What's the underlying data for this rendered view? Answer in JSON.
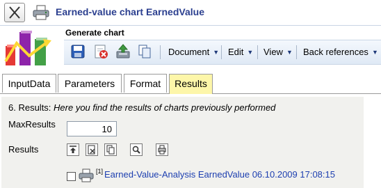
{
  "window": {
    "title": "Earned-value chart EarnedValue"
  },
  "toolbar": {
    "section_label": "Generate chart",
    "icons": [
      "save-icon",
      "delete-icon",
      "upload-icon",
      "copy-icon"
    ],
    "menus": [
      {
        "label": "Document"
      },
      {
        "label": "Edit"
      },
      {
        "label": "View"
      },
      {
        "label": "Back references"
      }
    ]
  },
  "tabs": [
    {
      "label": "InputData",
      "active": false
    },
    {
      "label": "Parameters",
      "active": false
    },
    {
      "label": "Format",
      "active": false
    },
    {
      "label": "Results",
      "active": true
    }
  ],
  "panel": {
    "heading_prefix": "6. Results: ",
    "heading_italic": "Here you find the results of charts previously performed",
    "max_results_label": "MaxResults",
    "max_results_value": "10",
    "results_label": "Results",
    "result_actions": [
      "export-icon",
      "remove-icon",
      "copy-icon",
      "search-icon",
      "print-icon"
    ],
    "results": [
      {
        "footnote": "[1]",
        "link": "Earned-Value-Analysis EarnedValue 06.10.2009 17:08:15",
        "checked": false
      }
    ]
  },
  "colors": {
    "title": "#2b3f8f",
    "link": "#1d3fb0",
    "active_tab": "#fdf6a9",
    "panel_bg": "#f1f1ee"
  }
}
